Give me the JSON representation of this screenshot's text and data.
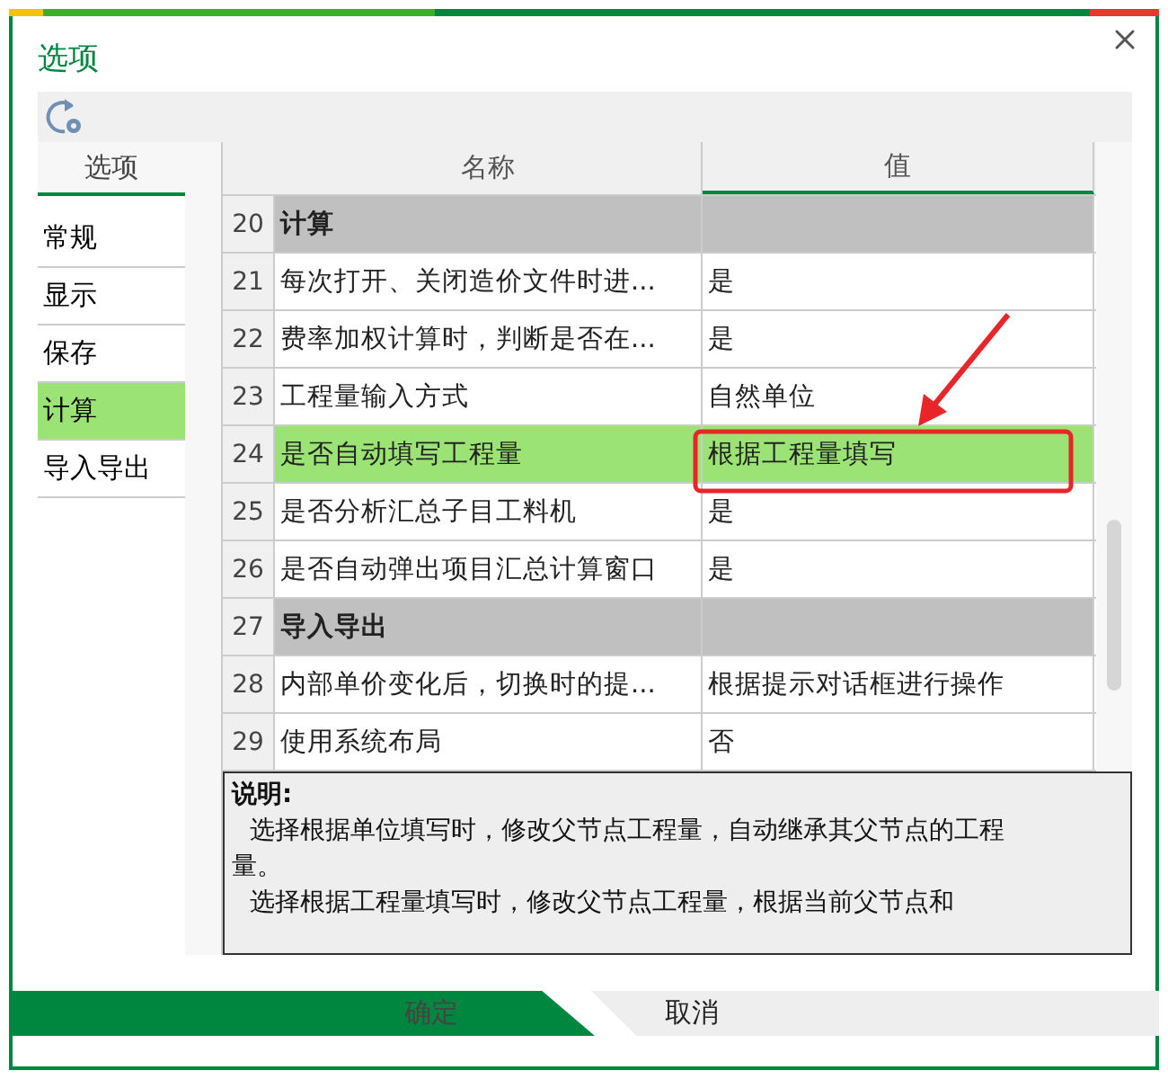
{
  "window": {
    "title": "选项"
  },
  "sidebar": {
    "header": "选项",
    "items": [
      {
        "label": "常规",
        "selected": false
      },
      {
        "label": "显示",
        "selected": false
      },
      {
        "label": "保存",
        "selected": false
      },
      {
        "label": "计算",
        "selected": true
      },
      {
        "label": "导入导出",
        "selected": false
      }
    ]
  },
  "table": {
    "columns": [
      "名称",
      "值"
    ],
    "rows": [
      {
        "kind": "group",
        "number": "20",
        "name": "计算",
        "value": "",
        "selected": false
      },
      {
        "kind": "item",
        "number": "21",
        "name": "每次打开、关闭造价文件时进...",
        "value": "是",
        "selected": false
      },
      {
        "kind": "item",
        "number": "22",
        "name": "费率加权计算时，判断是否在...",
        "value": "是",
        "selected": false
      },
      {
        "kind": "item",
        "number": "23",
        "name": "工程量输入方式",
        "value": "自然单位",
        "selected": false
      },
      {
        "kind": "item",
        "number": "24",
        "name": "是否自动填写工程量",
        "value": "根据工程量填写",
        "selected": true
      },
      {
        "kind": "item",
        "number": "25",
        "name": "是否分析汇总子目工料机",
        "value": "是",
        "selected": false
      },
      {
        "kind": "item",
        "number": "26",
        "name": "是否自动弹出项目汇总计算窗口",
        "value": "是",
        "selected": false
      },
      {
        "kind": "group",
        "number": "27",
        "name": "导入导出",
        "value": "",
        "selected": false
      },
      {
        "kind": "item",
        "number": "28",
        "name": "内部单价变化后，切换时的提...",
        "value": "根据提示对话框进行操作",
        "selected": false
      },
      {
        "kind": "item",
        "number": "29",
        "name": "使用系统布局",
        "value": "否",
        "selected": false
      }
    ]
  },
  "description": {
    "heading": "说明:",
    "paragraphs": [
      "选择根据单位填写时，修改父节点工程量，自动继承其父节点的工程量。",
      "选择根据工程量填写时，修改父节点工程量，根据当前父节点和"
    ]
  },
  "buttons": [
    {
      "label": "确定",
      "kind": "primary"
    },
    {
      "label": "取消",
      "kind": "secondary"
    }
  ]
}
